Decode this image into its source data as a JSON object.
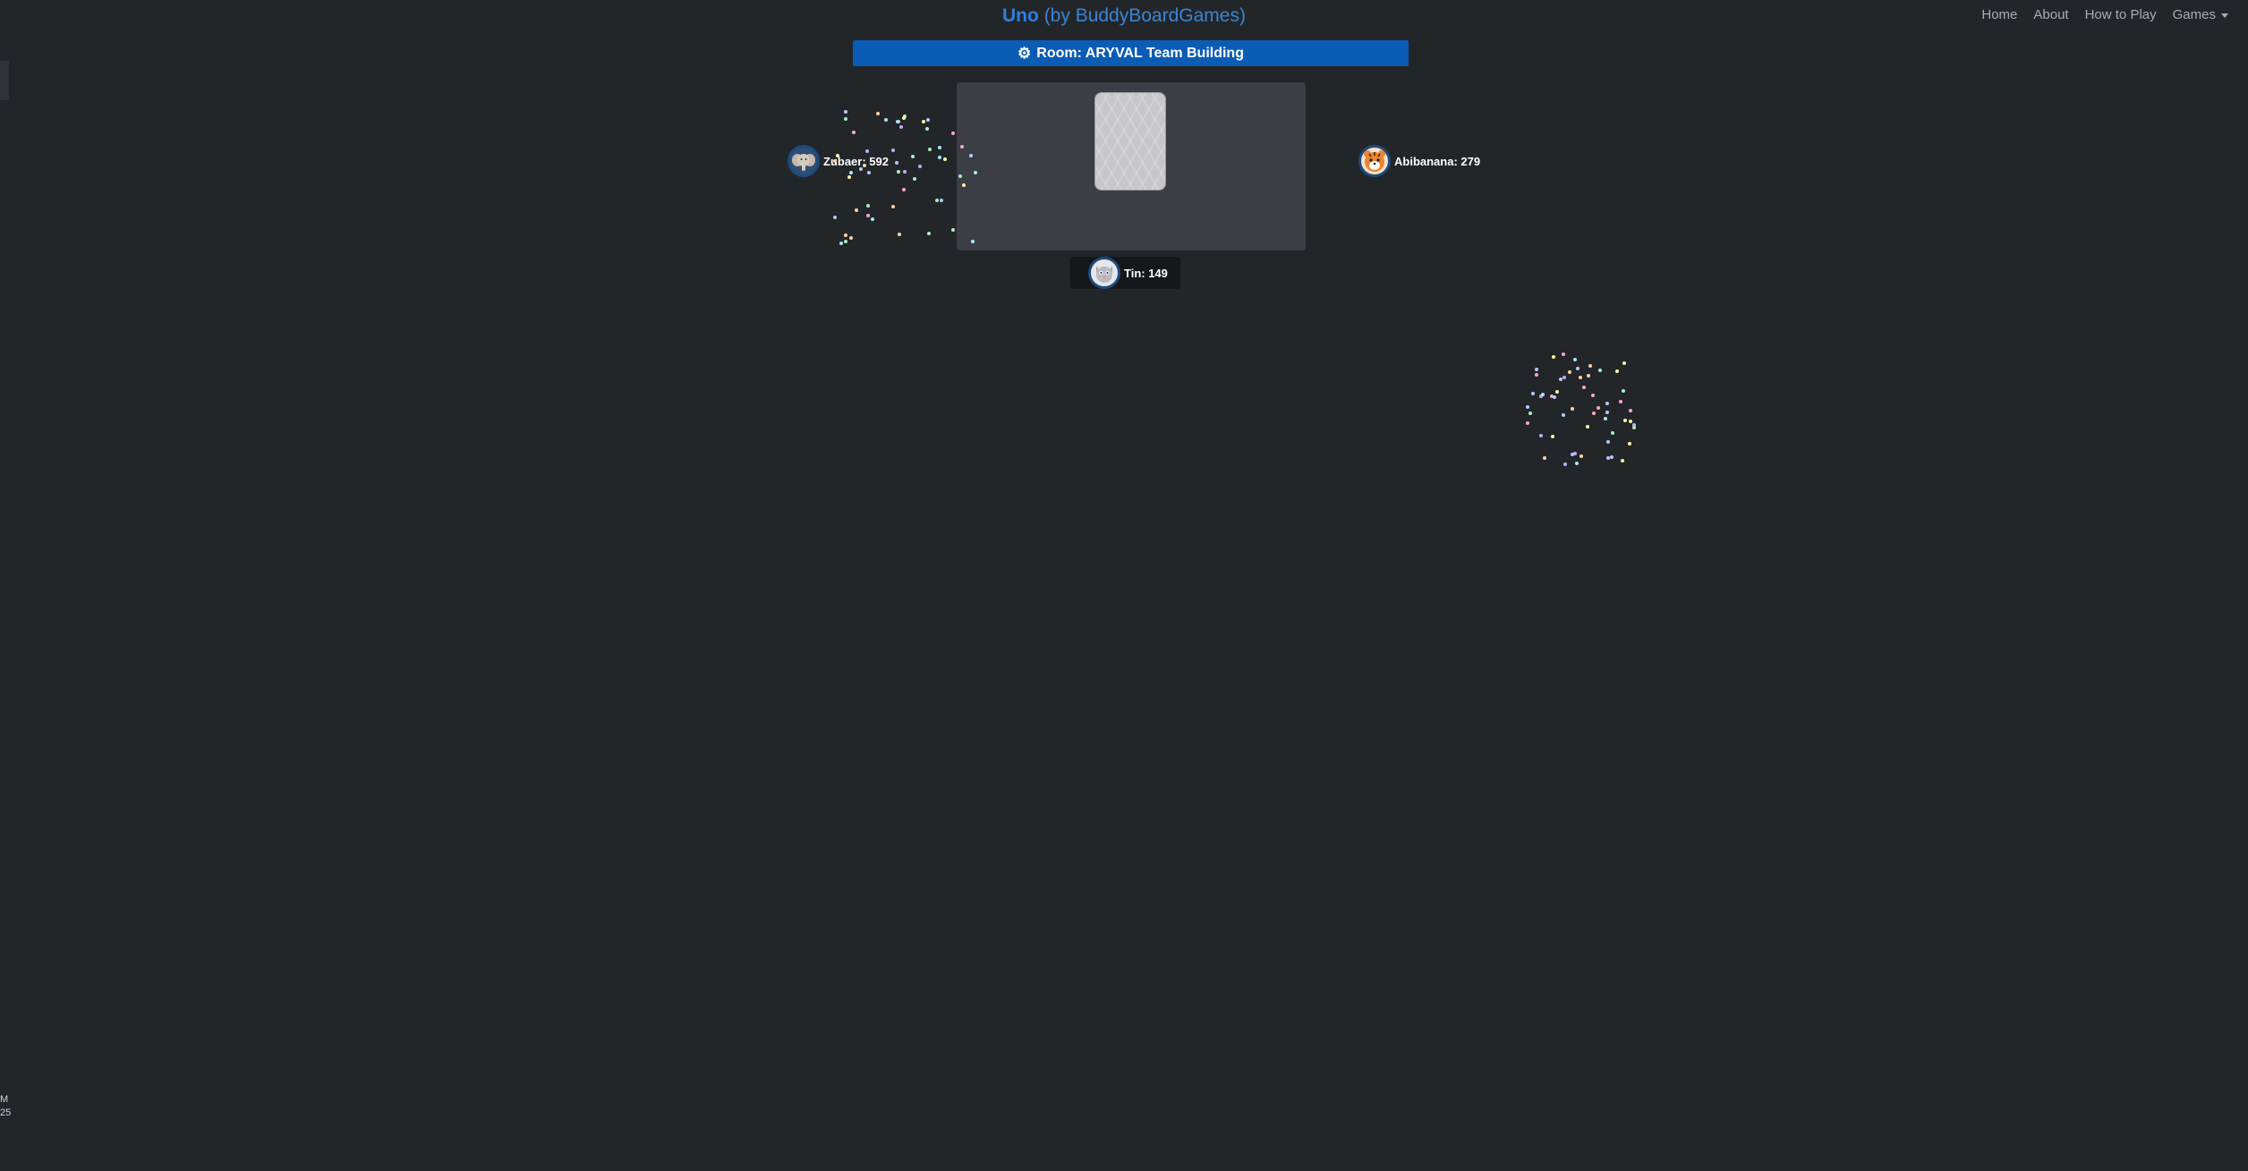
{
  "header": {
    "brand_main": "Uno",
    "brand_sub": "(by BuddyBoardGames)",
    "nav": {
      "home": "Home",
      "about": "About",
      "how_to_play": "How to Play",
      "games": "Games"
    }
  },
  "room": {
    "icon": "gear-icon",
    "label": "Room: ARYVAL Team Building"
  },
  "players": [
    {
      "name": "Zubaer",
      "score": 592,
      "label": "Zubaer: 592",
      "avatar": "elephant-avatar"
    },
    {
      "name": "Abibanana",
      "score": 279,
      "label": "Abibanana: 279",
      "avatar": "tiger-avatar"
    },
    {
      "name": "Tin",
      "score": 149,
      "label": "Tin: 149",
      "avatar": "cat-avatar"
    }
  ],
  "table": {
    "draw_pile": "face-down-card"
  },
  "edge": {
    "text1": "M",
    "text2": "25"
  },
  "colors": {
    "background": "#232629",
    "brand": "#2f80dc",
    "room_bar": "#0b5cb4",
    "table": "#3b3e44"
  }
}
